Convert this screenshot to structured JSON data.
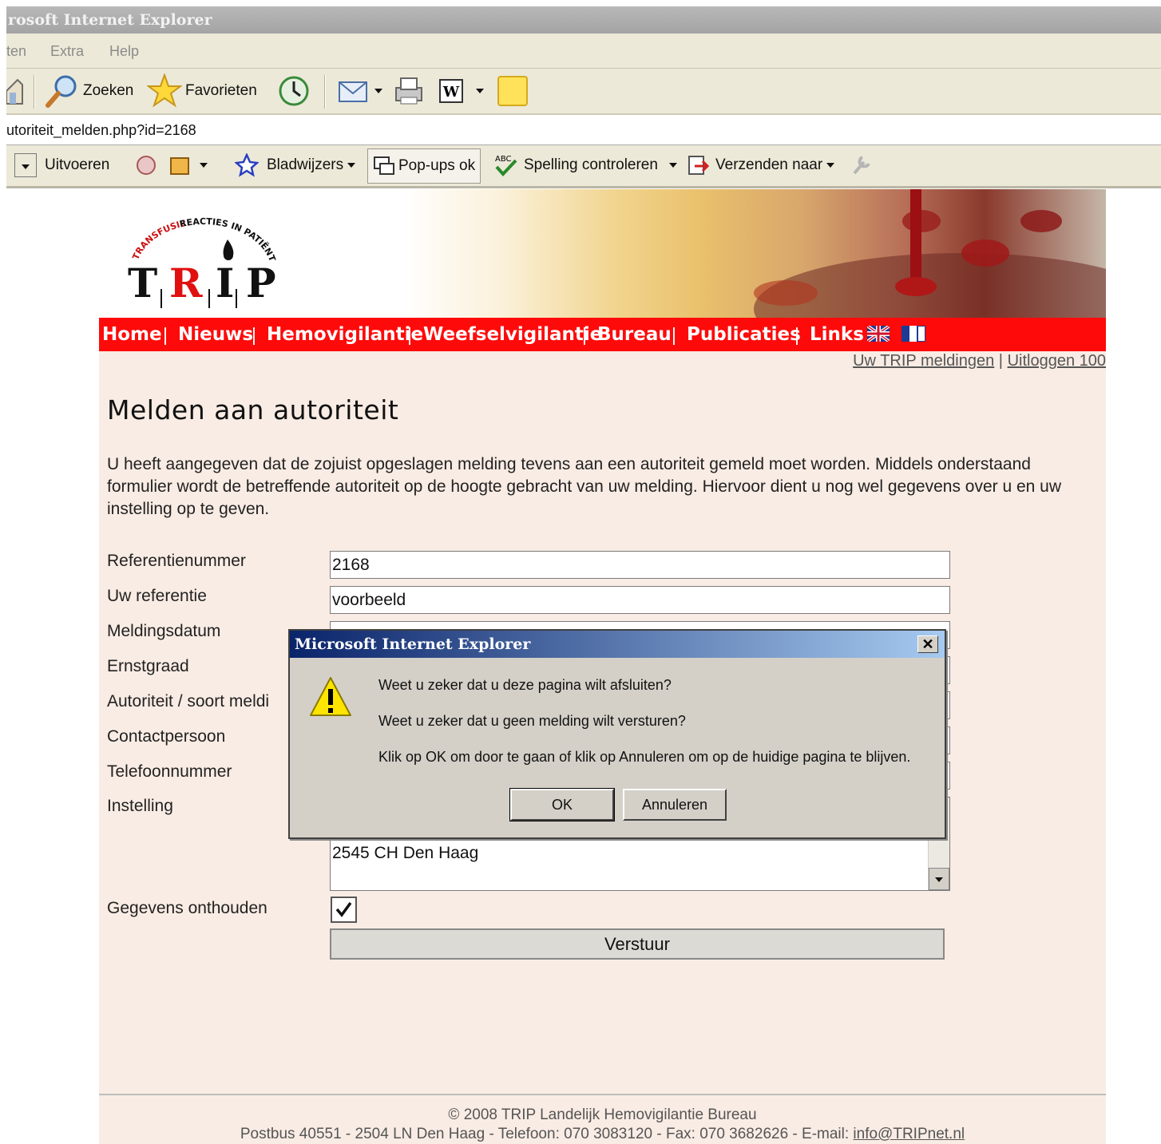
{
  "browser": {
    "title": "rosoft Internet Explorer",
    "menu": [
      "ten",
      "Extra",
      "Help"
    ],
    "toolbar": {
      "search_label": "Zoeken",
      "favorites_label": "Favorieten"
    },
    "address": "utoriteit_melden.php?id=2168",
    "links_toolbar": {
      "run_label": "Uitvoeren",
      "bookmarks_label": "Bladwijzers",
      "popups_label": "Pop-ups ok",
      "spelling_label": "Spelling controleren",
      "send_label": "Verzenden naar"
    }
  },
  "site": {
    "logo_text": "TRIP",
    "logo_arc": "TRANSFUSIE REACTIES IN PATIËNTEN",
    "nav": [
      "Home",
      "Nieuws",
      "Hemovigilantie",
      "Weefselvigilantie",
      "Bureau",
      "Publicaties",
      "Links"
    ],
    "user_links": {
      "meldingen": "Uw TRIP meldingen",
      "sep": "|",
      "logout": "Uitloggen 100"
    }
  },
  "main": {
    "heading": "Melden aan autoriteit",
    "intro": "U heeft aangegeven dat de zojuist opgeslagen melding tevens aan een autoriteit gemeld moet worden. Middels onderstaand formulier wordt de betreffende autoriteit op de hoogte gebracht van uw melding. Hiervoor dient u nog wel gegevens over u en uw instelling op te geven.",
    "form": {
      "labels": [
        "Referentienummer",
        "Uw referentie",
        "Meldingsdatum",
        "Ernstgraad",
        "Autoriteit / soort meldi",
        "Contactpersoon",
        "Telefoonnummer",
        "Instelling"
      ],
      "referentienummer": "2168",
      "uw_referentie": "voorbeeld",
      "instelling_visible": "2545 CH Den Haag",
      "remember_label": "Gegevens onthouden",
      "remember_checked": true,
      "submit_label": "Verstuur"
    }
  },
  "footer": {
    "line1": "© 2008 TRIP Landelijk Hemovigilantie Bureau",
    "line2": "Postbus 40551 - 2504 LN Den Haag - Telefoon: 070 3083120 - Fax: 070 3682626 - E-mail: ",
    "email": "info@TRIPnet.nl"
  },
  "dialog": {
    "title": "Microsoft Internet Explorer",
    "line1": "Weet u zeker dat u deze pagina wilt afsluiten?",
    "line2": "Weet u zeker dat u geen melding wilt versturen?",
    "line3": "Klik op OK om door te gaan of klik op Annuleren om op de huidige pagina te blijven.",
    "ok_label": "OK",
    "cancel_label": "Annuleren"
  },
  "colors": {
    "nav_red": "#ff0a0a",
    "page_bg": "#f9ece4",
    "dialog_title": "#0a246a"
  }
}
